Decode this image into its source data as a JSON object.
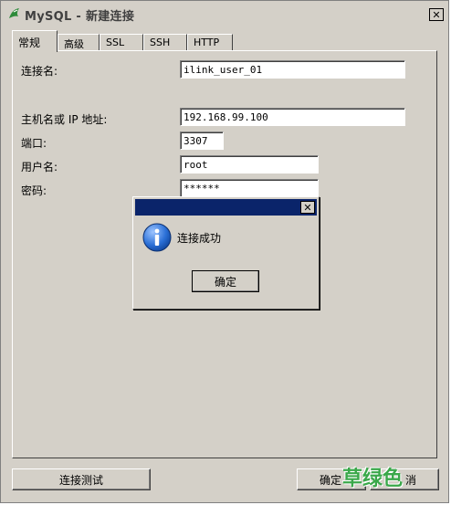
{
  "window": {
    "title": "MySQL - 新建连接",
    "close_glyph": "✕",
    "app_icon": "dolphin-icon"
  },
  "tabs": [
    {
      "label": "常规",
      "active": true
    },
    {
      "label": "高级",
      "active": false
    },
    {
      "label": "SSL",
      "active": false
    },
    {
      "label": "SSH",
      "active": false
    },
    {
      "label": "HTTP",
      "active": false
    }
  ],
  "form": {
    "connection_name": {
      "label": "连接名:",
      "value": "ilink_user_01"
    },
    "host": {
      "label": "主机名或 IP 地址:",
      "value": "192.168.99.100"
    },
    "port": {
      "label": "端口:",
      "value": "3307"
    },
    "username": {
      "label": "用户名:",
      "value": "root"
    },
    "password": {
      "label": "密码:",
      "value": "******"
    }
  },
  "dialog": {
    "title": "",
    "close_glyph": "✕",
    "message": "连接成功",
    "icon": "info-icon",
    "ok_label": "确定"
  },
  "footer": {
    "test_label": "连接测试",
    "ok_label": "确定",
    "cancel_label_visible": "消"
  },
  "watermark": "草绿色",
  "colors": {
    "face": "#d4d0c8",
    "title_active": "#0a246a",
    "info_blue": "#1f5fbf",
    "watermark_green": "#3aa84a",
    "dolphin_green": "#2e8b3a"
  }
}
